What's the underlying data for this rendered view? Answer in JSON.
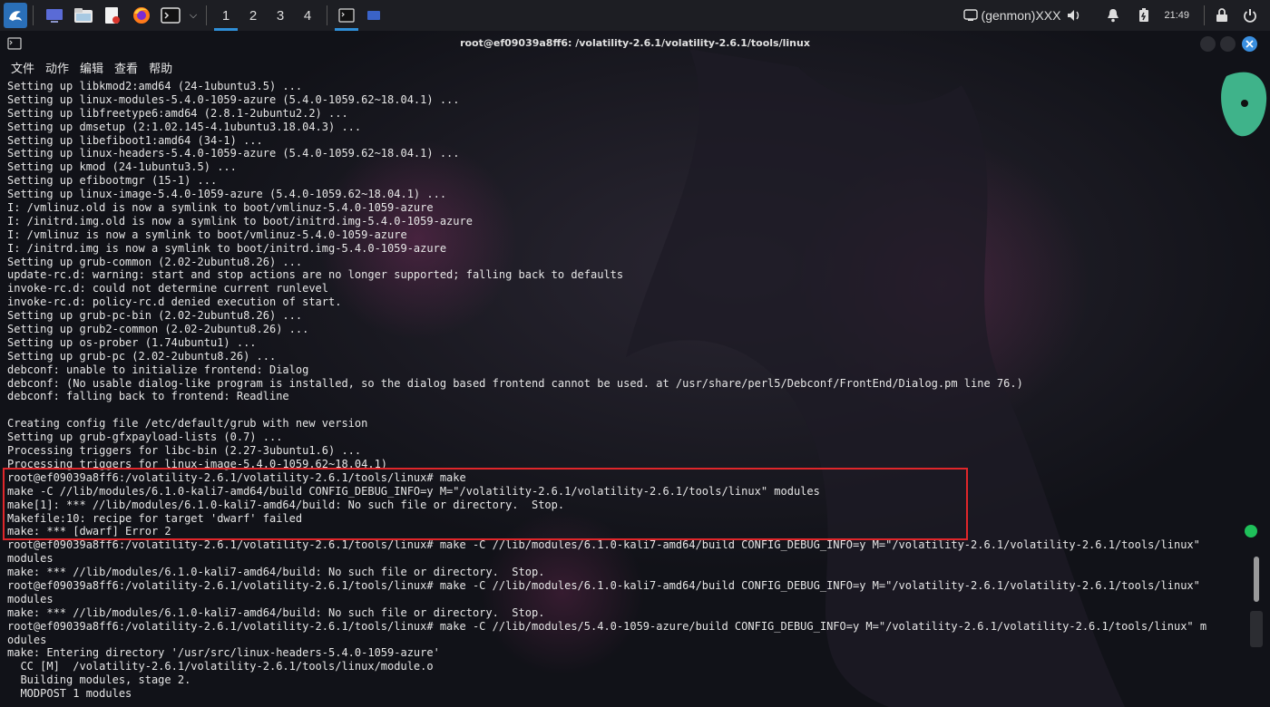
{
  "panel": {
    "workspaces": [
      "1",
      "2",
      "3",
      "4"
    ],
    "active_workspace": "1",
    "genmon": "(genmon)XXX",
    "clock": "21:49"
  },
  "window": {
    "title": "root@ef09039a8ff6: /volatility-2.6.1/volatility-2.6.1/tools/linux"
  },
  "menu": [
    "文件",
    "动作",
    "编辑",
    "查看",
    "帮助"
  ],
  "terminal": {
    "lines": [
      "Setting up libkmod2:amd64 (24-1ubuntu3.5) ...",
      "Setting up linux-modules-5.4.0-1059-azure (5.4.0-1059.62~18.04.1) ...",
      "Setting up libfreetype6:amd64 (2.8.1-2ubuntu2.2) ...",
      "Setting up dmsetup (2:1.02.145-4.1ubuntu3.18.04.3) ...",
      "Setting up libefiboot1:amd64 (34-1) ...",
      "Setting up linux-headers-5.4.0-1059-azure (5.4.0-1059.62~18.04.1) ...",
      "Setting up kmod (24-1ubuntu3.5) ...",
      "Setting up efibootmgr (15-1) ...",
      "Setting up linux-image-5.4.0-1059-azure (5.4.0-1059.62~18.04.1) ...",
      "I: /vmlinuz.old is now a symlink to boot/vmlinuz-5.4.0-1059-azure",
      "I: /initrd.img.old is now a symlink to boot/initrd.img-5.4.0-1059-azure",
      "I: /vmlinuz is now a symlink to boot/vmlinuz-5.4.0-1059-azure",
      "I: /initrd.img is now a symlink to boot/initrd.img-5.4.0-1059-azure",
      "Setting up grub-common (2.02-2ubuntu8.26) ...",
      "update-rc.d: warning: start and stop actions are no longer supported; falling back to defaults",
      "invoke-rc.d: could not determine current runlevel",
      "invoke-rc.d: policy-rc.d denied execution of start.",
      "Setting up grub-pc-bin (2.02-2ubuntu8.26) ...",
      "Setting up grub2-common (2.02-2ubuntu8.26) ...",
      "Setting up os-prober (1.74ubuntu1) ...",
      "Setting up grub-pc (2.02-2ubuntu8.26) ...",
      "debconf: unable to initialize frontend: Dialog",
      "debconf: (No usable dialog-like program is installed, so the dialog based frontend cannot be used. at /usr/share/perl5/Debconf/FrontEnd/Dialog.pm line 76.)",
      "debconf: falling back to frontend: Readline",
      "",
      "Creating config file /etc/default/grub with new version",
      "Setting up grub-gfxpayload-lists (0.7) ...",
      "Processing triggers for libc-bin (2.27-3ubuntu1.6) ...",
      "Processing triggers for linux-image-5.4.0-1059.62~18.04.1)",
      "root@ef09039a8ff6:/volatility-2.6.1/volatility-2.6.1/tools/linux# make",
      "make -C //lib/modules/6.1.0-kali7-amd64/build CONFIG_DEBUG_INFO=y M=\"/volatility-2.6.1/volatility-2.6.1/tools/linux\" modules",
      "make[1]: *** //lib/modules/6.1.0-kali7-amd64/build: No such file or directory.  Stop.",
      "Makefile:10: recipe for target 'dwarf' failed",
      "make: *** [dwarf] Error 2",
      "root@ef09039a8ff6:/volatility-2.6.1/volatility-2.6.1/tools/linux# make -C //lib/modules/6.1.0-kali7-amd64/build CONFIG_DEBUG_INFO=y M=\"/volatility-2.6.1/volatility-2.6.1/tools/linux\"",
      "modules",
      "make: *** //lib/modules/6.1.0-kali7-amd64/build: No such file or directory.  Stop.",
      "root@ef09039a8ff6:/volatility-2.6.1/volatility-2.6.1/tools/linux# make -C //lib/modules/6.1.0-kali7-amd64/build CONFIG_DEBUG_INFO=y M=\"/volatility-2.6.1/volatility-2.6.1/tools/linux\"",
      "modules",
      "make: *** //lib/modules/6.1.0-kali7-amd64/build: No such file or directory.  Stop.",
      "root@ef09039a8ff6:/volatility-2.6.1/volatility-2.6.1/tools/linux# make -C //lib/modules/5.4.0-1059-azure/build CONFIG_DEBUG_INFO=y M=\"/volatility-2.6.1/volatility-2.6.1/tools/linux\" m",
      "odules",
      "make: Entering directory '/usr/src/linux-headers-5.4.0-1059-azure'",
      "  CC [M]  /volatility-2.6.1/volatility-2.6.1/tools/linux/module.o",
      "  Building modules, stage 2.",
      "  MODPOST 1 modules"
    ]
  },
  "colors": {
    "highlight": "#e0262a",
    "accent": "#2f8fd8",
    "panel_bg": "#1d1e23",
    "terminal_text": "#e6e6e6"
  },
  "icons": {
    "launcher": "kali-dragon-icon",
    "tray": [
      "genmon-icon",
      "volume-icon",
      "notification-bell-icon",
      "battery-icon",
      "lock-icon",
      "power-icon"
    ]
  }
}
